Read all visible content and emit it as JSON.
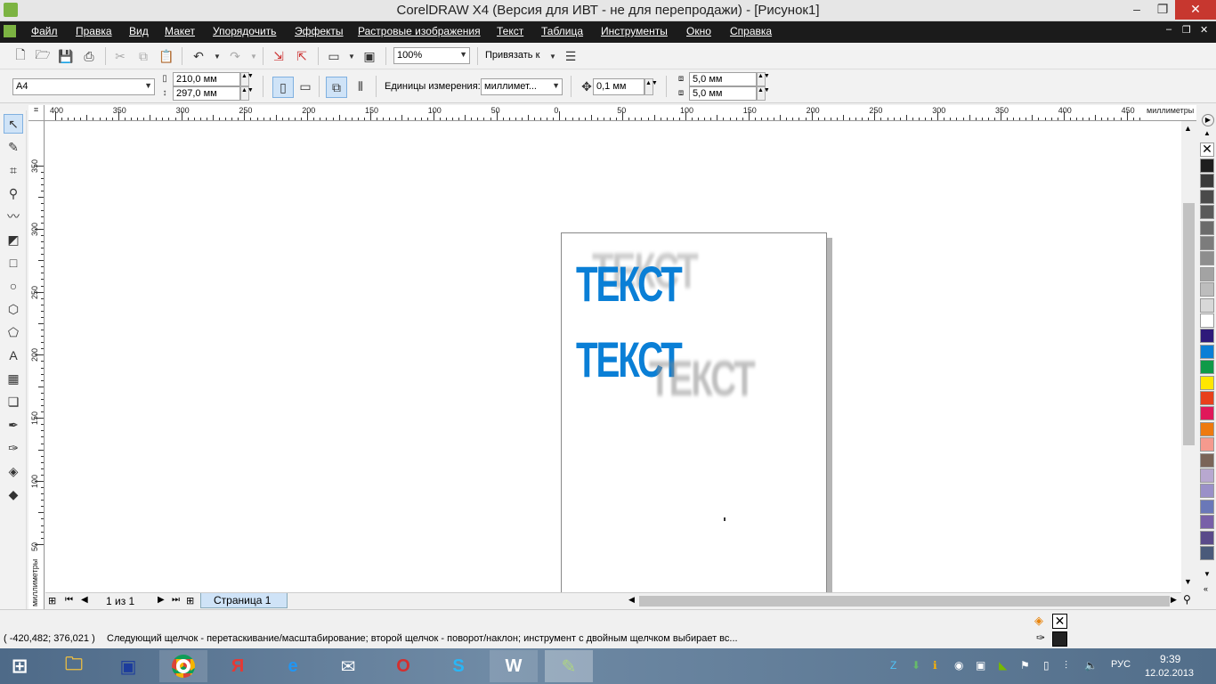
{
  "window": {
    "title": "CorelDRAW X4 (Версия для ИВТ - не для перепродажи) - [Рисунок1]"
  },
  "menu": [
    "Файл",
    "Правка",
    "Вид",
    "Макет",
    "Упорядочить",
    "Эффекты",
    "Растровые изображения",
    "Текст",
    "Таблица",
    "Инструменты",
    "Окно",
    "Справка"
  ],
  "toolbar": {
    "zoom": "100%",
    "snap_label": "Привязать к"
  },
  "propertybar": {
    "page_size": "A4",
    "width": "210,0 мм",
    "height": "297,0 мм",
    "units_label": "Единицы измерения:",
    "units_value": "миллимет...",
    "nudge": "0,1 мм",
    "dup_x": "5,0 мм",
    "dup_y": "5,0 мм"
  },
  "ruler": {
    "h_labels": [
      "400",
      "350",
      "300",
      "250",
      "200",
      "150",
      "100",
      "50",
      "0",
      "50",
      "100",
      "150",
      "200",
      "250",
      "300",
      "350",
      "400",
      "450"
    ],
    "h_unit": "миллиметры",
    "v_labels": [
      "350",
      "300",
      "250",
      "200",
      "150",
      "100",
      "50"
    ],
    "v_unit": "миллиметры"
  },
  "canvas": {
    "text1": "ТЕКСТ",
    "text1_shadow": "ТЕКСТ",
    "text2": "ТЕКСТ",
    "text2_shadow": "ТЕКСТ",
    "text_color": "#0a7fd6",
    "shadow_color": "#8a8a8a"
  },
  "pagebar": {
    "counter": "1 из 1",
    "tab": "Страница 1"
  },
  "status": {
    "coords": "( -420,482; 376,021 )",
    "hint": "Следующий щелчок - перетаскивание/масштабирование; второй щелчок - поворот/наклон; инструмент с двойным щелчком выбирает вс..."
  },
  "palette": [
    "#1e1e1e",
    "#3a3a3a",
    "#4a4a4a",
    "#5a5a5a",
    "#6b6b6b",
    "#7c7c7c",
    "#8e8e8e",
    "#a3a3a3",
    "#bdbdbd",
    "#d8d8d8",
    "#ffffff",
    "#2e1a7a",
    "#0a7fd6",
    "#0f9a48",
    "#ffe600",
    "#e8401c",
    "#e0185a",
    "#ee7a10",
    "#f59a8e",
    "#7a6458",
    "#b8a8d0",
    "#9a90c8",
    "#6a78b8",
    "#7860a8",
    "#5a4a8a",
    "#4a5a7a"
  ],
  "taskbar": {
    "time": "9:39",
    "date": "12.02.2013",
    "lang": "РУС"
  }
}
